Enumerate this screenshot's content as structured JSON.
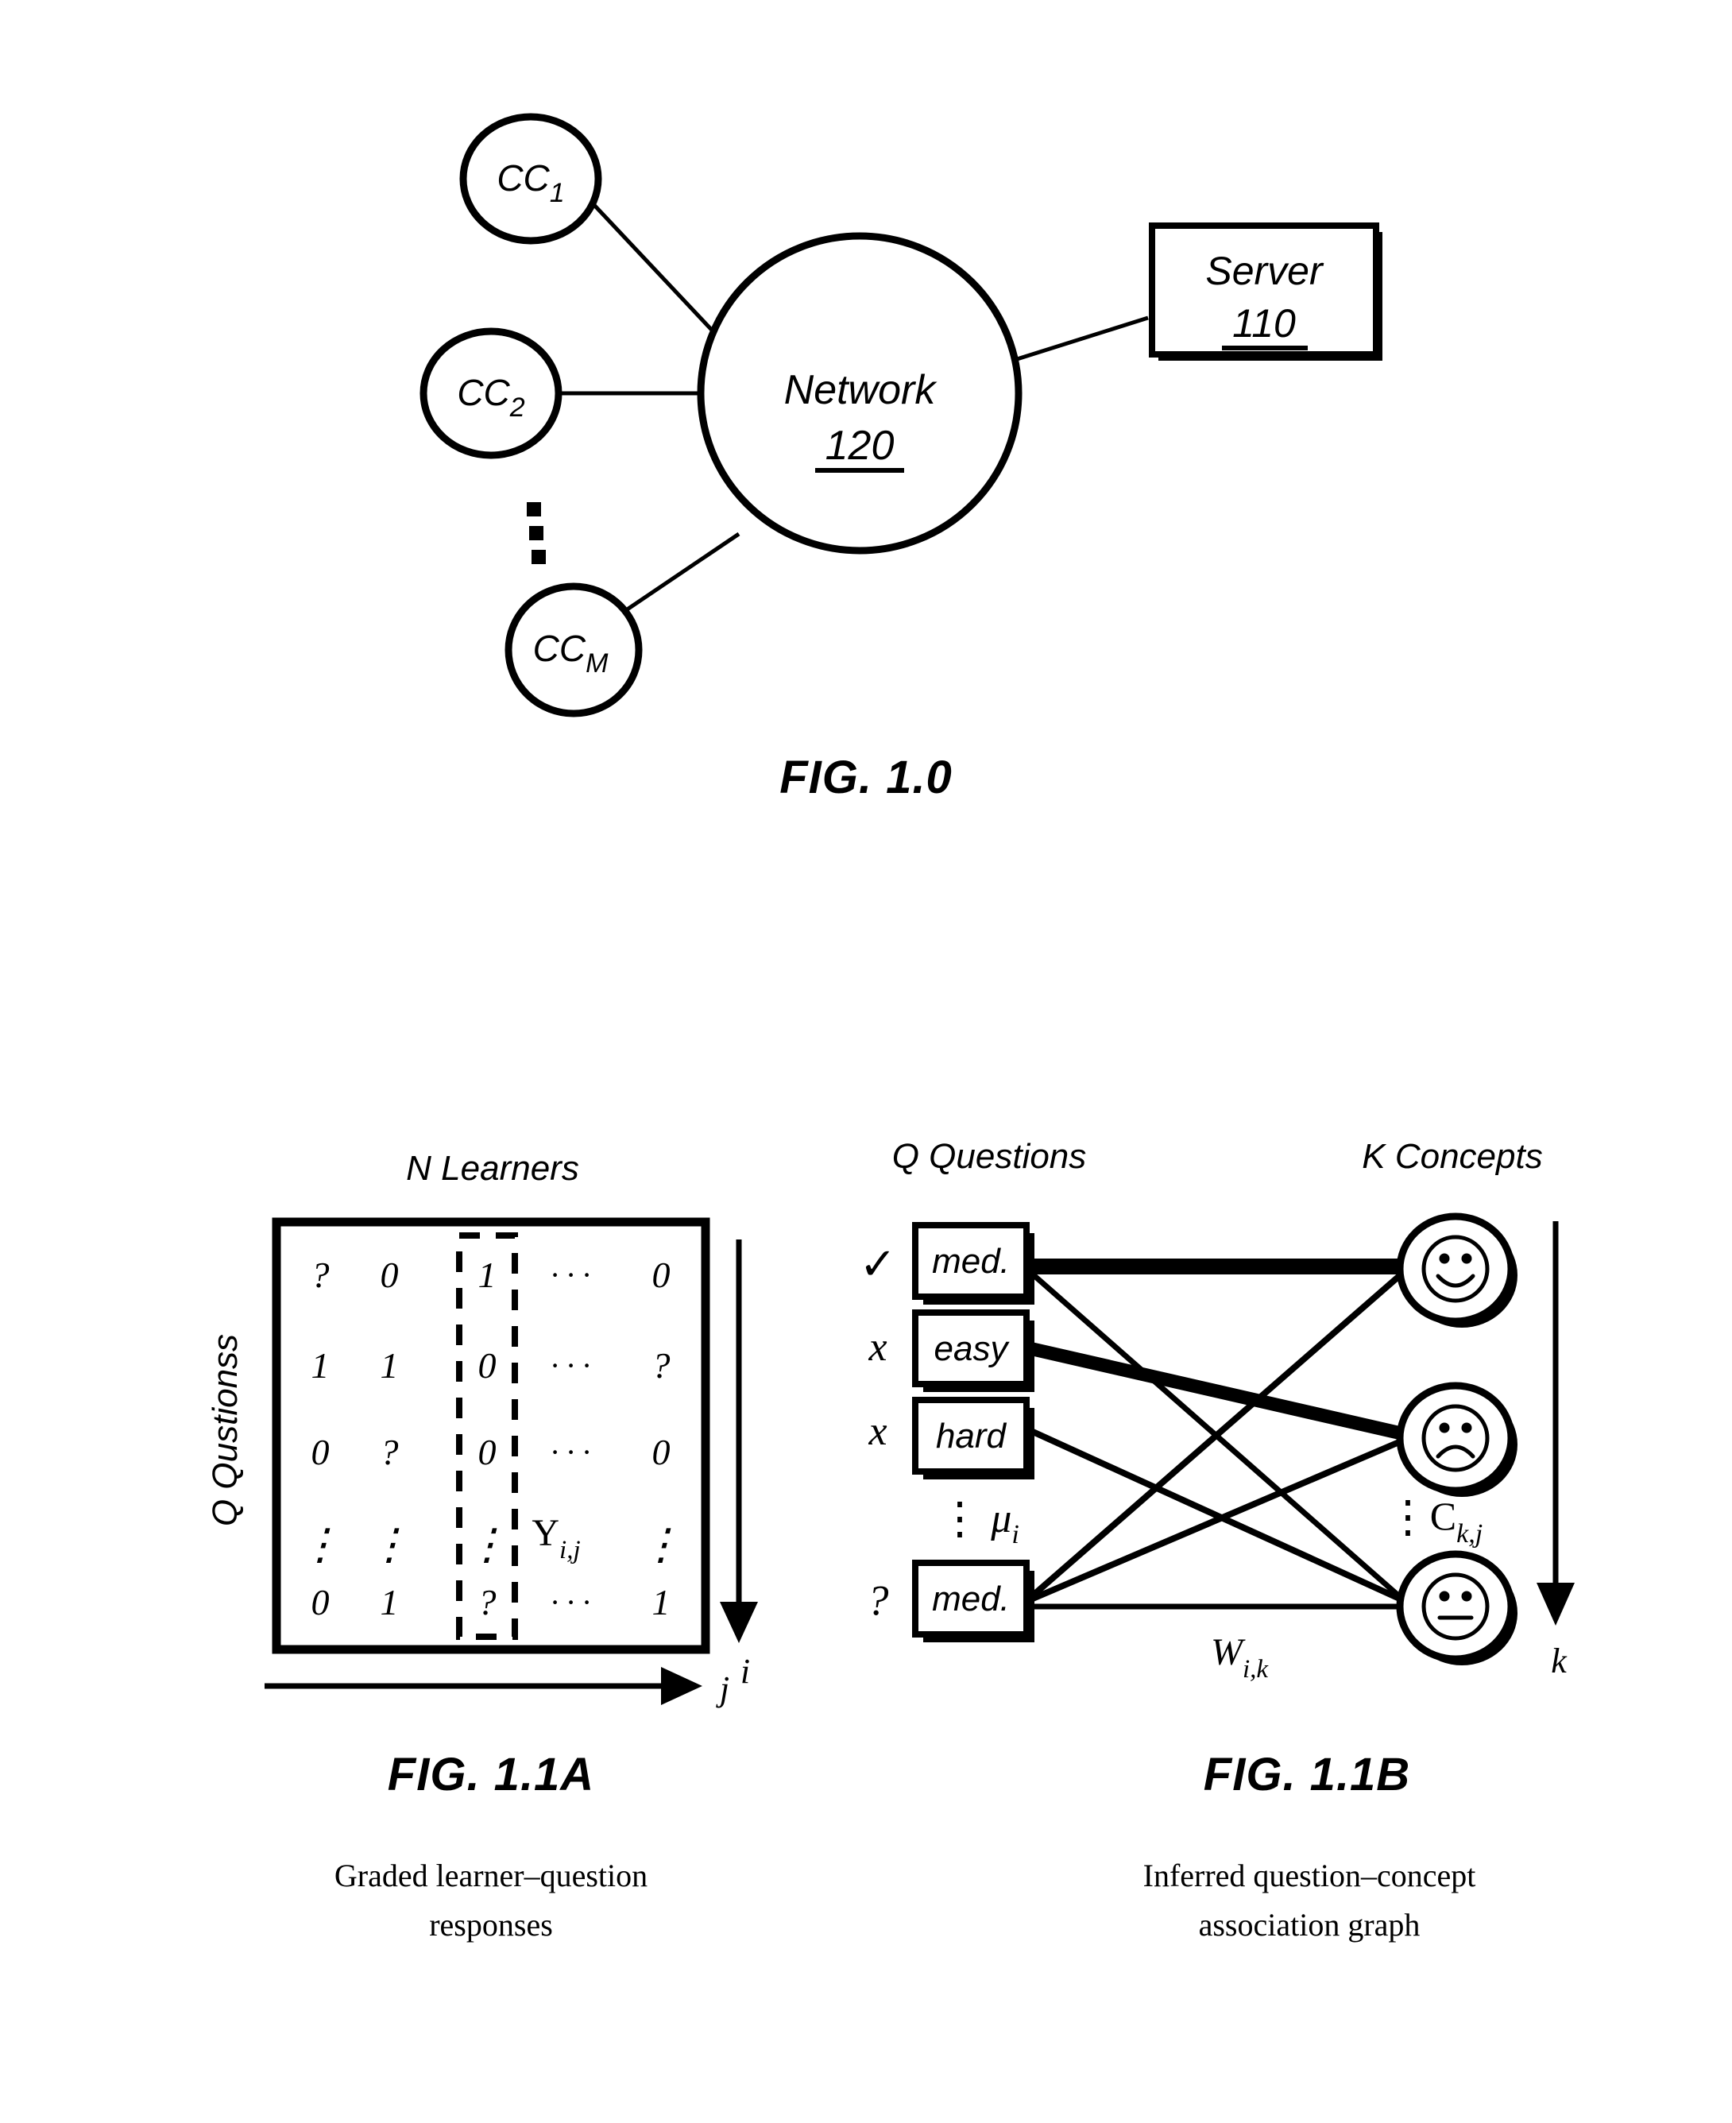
{
  "figures": [
    {
      "id": "fig-1-0",
      "caption": "FIG. 1.0",
      "nodes": {
        "clients": [
          {
            "label": "CC",
            "sub": "1"
          },
          {
            "label": "CC",
            "sub": "2"
          },
          {
            "label": "CC",
            "sub": "M"
          }
        ],
        "network": {
          "label": "Network",
          "ref": "120"
        },
        "server": {
          "label": "Server",
          "ref": "110"
        }
      },
      "ellipsis": "vertical-dots"
    },
    {
      "id": "fig-1-1a",
      "caption": "FIG. 1.1A",
      "sub_caption_line1": "Graded learner–question",
      "sub_caption_line2": "responses",
      "top_label": "N Learners",
      "left_label": "Q Qustionss",
      "row_axis_label": "i",
      "col_axis_label": "j",
      "entry_label": "Y",
      "entry_label_sub": "i,j",
      "matrix": [
        [
          "?",
          "0",
          "1",
          "· · ·",
          "0"
        ],
        [
          "1",
          "1",
          "0",
          "· · ·",
          "?"
        ],
        [
          "0",
          "?",
          "0",
          "· · ·",
          "0"
        ],
        [
          "⋮",
          "⋮",
          "⋮",
          "",
          "⋮"
        ],
        [
          "0",
          "1",
          "?",
          "· · ·",
          "1"
        ]
      ],
      "highlighted_column_index": 2
    },
    {
      "id": "fig-1-1b",
      "caption": "FIG. 1.1B",
      "sub_caption_line1": "Inferred question–concept",
      "sub_caption_line2": "association graph",
      "left_label": "Q Questions",
      "right_label": "K Concepts",
      "axis_label": "k",
      "edge_weight_label": "W",
      "edge_weight_label_sub": "i,k",
      "difficulty_label": "μ",
      "difficulty_label_sub": "i",
      "concept_label": "C",
      "concept_label_sub": "k,j",
      "questions": [
        {
          "mark": "✓",
          "difficulty": "med."
        },
        {
          "mark": "x",
          "difficulty": "easy"
        },
        {
          "mark": "x",
          "difficulty": "hard"
        },
        {
          "mark": "?",
          "difficulty": "med."
        }
      ],
      "questions_ellipsis": "⋮",
      "concepts": [
        {
          "face": "happy-face-icon"
        },
        {
          "face": "sad-face-icon"
        },
        {
          "face": "neutral-face-icon"
        }
      ],
      "concepts_ellipsis": "⋮",
      "edges": [
        {
          "from": 0,
          "to": 0,
          "weight": "thick"
        },
        {
          "from": 0,
          "to": 2,
          "weight": "thin"
        },
        {
          "from": 1,
          "to": 1,
          "weight": "thick"
        },
        {
          "from": 2,
          "to": 2,
          "weight": "thin"
        },
        {
          "from": 3,
          "to": 0,
          "weight": "thin"
        },
        {
          "from": 3,
          "to": 1,
          "weight": "thin"
        },
        {
          "from": 3,
          "to": 2,
          "weight": "thin"
        }
      ]
    }
  ],
  "colors": {
    "ink": "#000000",
    "paper": "#ffffff"
  }
}
